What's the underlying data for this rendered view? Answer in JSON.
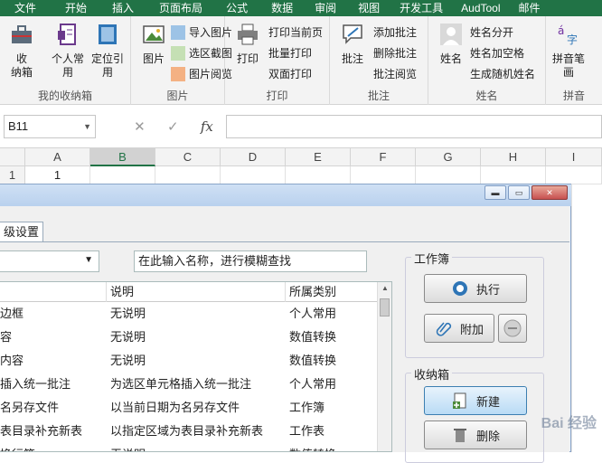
{
  "ribbon_tabs": [
    "文件",
    "开始",
    "插入",
    "页面布局",
    "公式",
    "数据",
    "审阅",
    "视图",
    "开发工具",
    "AudTool",
    "邮件"
  ],
  "ribbon": {
    "group1": {
      "label": "我的收纳箱",
      "btn1": "收\n纳箱",
      "btn2": "个人常\n用",
      "btn3": "定位引\n用"
    },
    "group2": {
      "label": "图片",
      "btn": "图片",
      "small": [
        "导入图片",
        "选区截图",
        "图片阅览"
      ]
    },
    "group3": {
      "label": "打印",
      "btn": "打印",
      "small": [
        "打印当前页",
        "批量打印",
        "双面打印"
      ]
    },
    "group4": {
      "label": "批注",
      "btn": "批注",
      "small": [
        "添加批注",
        "删除批注",
        "批注阅览"
      ]
    },
    "group5": {
      "label": "姓名",
      "btn": "姓名",
      "small": [
        "姓名分开",
        "姓名加空格",
        "生成随机姓名"
      ]
    },
    "group6": {
      "label": "拼音",
      "btn": "拼音笔\n画"
    }
  },
  "formula_bar": {
    "name_box": "B11",
    "fx": "fx",
    "content": ""
  },
  "grid": {
    "columns": [
      "A",
      "B",
      "C",
      "D",
      "E",
      "F",
      "G",
      "H",
      "I"
    ],
    "rows": [
      {
        "num": "1",
        "a": "1"
      }
    ]
  },
  "dialog": {
    "tab_label": "级设置",
    "search_placeholder": "在此输入名称，进行模糊查找",
    "columns": [
      "说明",
      "所属类别"
    ],
    "rows": [
      {
        "name": "边框",
        "desc": "无说明",
        "cat": "个人常用"
      },
      {
        "name": "容",
        "desc": "无说明",
        "cat": "数值转换"
      },
      {
        "name": "内容",
        "desc": "无说明",
        "cat": "数值转换"
      },
      {
        "name": "插入统一批注",
        "desc": "为选区单元格插入统一批注",
        "cat": "个人常用"
      },
      {
        "name": "名另存文件",
        "desc": "以当前日期为名另存文件",
        "cat": "工作簿"
      },
      {
        "name": "表目录补充新表",
        "desc": "以指定区域为表目录补充新表",
        "cat": "工作表"
      },
      {
        "name": "换行符",
        "desc": "无说明",
        "cat": "数值转换"
      }
    ],
    "workbook_group": {
      "label": "工作簿",
      "execute": "执行",
      "attach": "附加"
    },
    "storage_group": {
      "label": "收纳箱",
      "new": "新建",
      "delete": "删除"
    }
  },
  "watermark": "Bai 经验",
  "colors": {
    "excel_green": "#217346",
    "ribbon_bg": "#f3f3f3",
    "dialog_title": "#b9d1ee"
  }
}
